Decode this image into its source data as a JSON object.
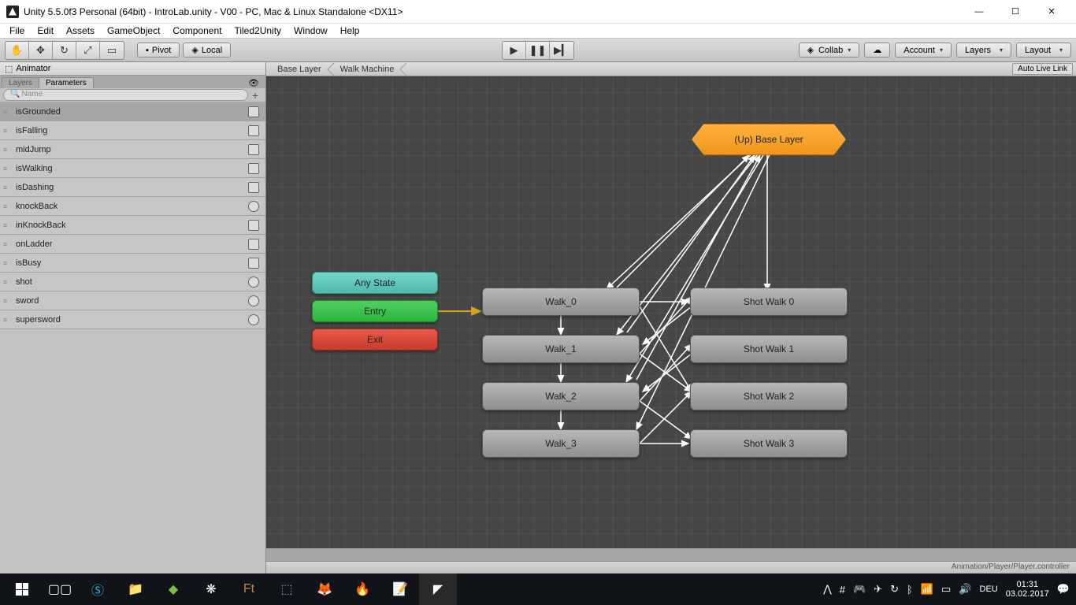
{
  "window": {
    "title": "Unity 5.5.0f3 Personal (64bit) - IntroLab.unity - V00 - PC, Mac & Linux Standalone <DX11>"
  },
  "menu": [
    "File",
    "Edit",
    "Assets",
    "GameObject",
    "Component",
    "Tiled2Unity",
    "Window",
    "Help"
  ],
  "toolbar": {
    "pivot": "Pivot",
    "local": "Local",
    "collab": "Collab",
    "account": "Account",
    "layers": "Layers",
    "layout": "Layout"
  },
  "animator": {
    "title": "Animator",
    "tabs": {
      "layers": "Layers",
      "parameters": "Parameters"
    },
    "searchPlaceholder": "Name",
    "params": [
      {
        "name": "isGrounded",
        "type": "bool",
        "selected": true
      },
      {
        "name": "isFalling",
        "type": "bool"
      },
      {
        "name": "midJump",
        "type": "bool"
      },
      {
        "name": "isWalking",
        "type": "bool"
      },
      {
        "name": "isDashing",
        "type": "bool"
      },
      {
        "name": "knockBack",
        "type": "trigger"
      },
      {
        "name": "inKnockBack",
        "type": "bool"
      },
      {
        "name": "onLadder",
        "type": "bool"
      },
      {
        "name": "isBusy",
        "type": "bool"
      },
      {
        "name": "shot",
        "type": "trigger"
      },
      {
        "name": "sword",
        "type": "trigger"
      },
      {
        "name": "supersword",
        "type": "trigger"
      }
    ]
  },
  "breadcrumb": [
    "Base Layer",
    "Walk Machine"
  ],
  "autolive": "Auto Live Link",
  "nodes": {
    "baseLayer": "(Up) Base Layer",
    "anyState": "Any State",
    "entry": "Entry",
    "exit": "Exit",
    "walk0": "Walk_0",
    "walk1": "Walk_1",
    "walk2": "Walk_2",
    "walk3": "Walk_3",
    "shot0": "Shot Walk 0",
    "shot1": "Shot Walk 1",
    "shot2": "Shot Walk 2",
    "shot3": "Shot Walk 3"
  },
  "status": "Animation/Player/Player.controller",
  "tray": {
    "lang": "DEU",
    "time": "01:31",
    "date": "03.02.2017"
  }
}
